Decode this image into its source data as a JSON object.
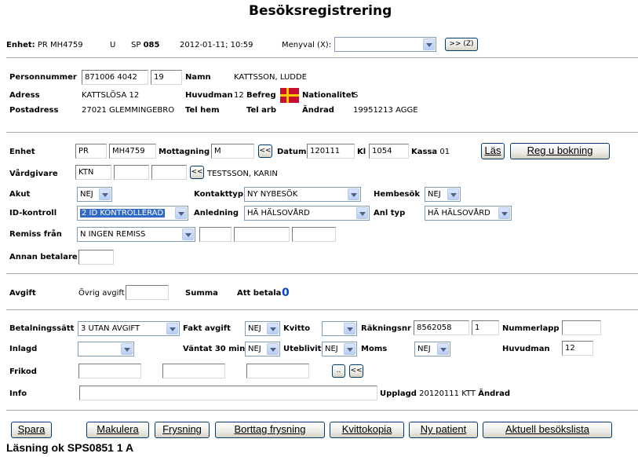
{
  "title": "Besöksregistrering",
  "header": {
    "enhet_label": "Enhet:",
    "enhet_value": "PR MH4759",
    "u": "U",
    "sp_label": "SP",
    "sp_value": "085",
    "datetime": "2012-01-11; 10:59",
    "menyval_label": "Menyval (X):",
    "menyval_value": "",
    "goto_button": ">> (Z)"
  },
  "patient": {
    "personnummer_label": "Personnummer",
    "personnummer_value": "871006 4042",
    "century_value": "19",
    "namn_label": "Namn",
    "namn_value": "KATTSSON, LUDDE",
    "adress_label": "Adress",
    "adress_value": "KATTSLÖSA 12",
    "huvudman_label": "Huvudman",
    "huvudman_value": "12",
    "befreg_label": "Befreg",
    "nationalitet_label": "Nationalitet",
    "nationalitet_value": "S",
    "postadress_label": "Postadress",
    "postadress_value": "27021  GLEMMINGEBRO",
    "telhem_label": "Tel hem",
    "telarb_label": "Tel arb",
    "andrad_label": "Ändrad",
    "andrad_value": "19951213 AGGE"
  },
  "visit": {
    "enhet_label": "Enhet",
    "enhet_a": "PR",
    "enhet_b": "MH4759",
    "mottagning_label": "Mottagning",
    "mottagning_value": "M",
    "mottagning_btn": "<<",
    "datum_label": "Datum",
    "datum_value": "120111",
    "kl_label": "Kl",
    "kl_value": "1054",
    "kassa_label": "Kassa",
    "kassa_value": "01",
    "las_button": "Läs",
    "regbokning_button": "Reg u bokning",
    "vardgivare_label": "Vårdgivare",
    "vardgivare_value": "KTN",
    "vardgivare_btn": "<<",
    "vardgivare_name": "TESTSSON, KARIN",
    "akut_label": "Akut",
    "akut_value": "NEJ",
    "kontakttyp_label": "Kontakttyp",
    "kontakttyp_value": "NY NYBESÖK",
    "hembesok_label": "Hembesök",
    "hembesok_value": "NEJ",
    "idkontroll_label": "ID-kontroll",
    "idkontroll_value": "2 ID KONTROLLERAD",
    "anledning_label": "Anledning",
    "anledning_value": "HÄ HÄLSOVÅRD",
    "anltyp_label": "Anl typ",
    "anltyp_value": "HÄ HÄLSOVÅRD",
    "remiss_label": "Remiss från",
    "remiss_value": "N INGEN REMISS",
    "annan_label": "Annan betalare"
  },
  "fee": {
    "avgift_label": "Avgift",
    "ovrig_label": "Övrig avgift",
    "summa_label": "Summa",
    "attbetala_label": "Att betala",
    "attbetala_value": "0"
  },
  "payment": {
    "betalningssatt_label": "Betalningssätt",
    "betalningssatt_value": "3 UTAN AVGIFT",
    "faktavgift_label": "Fakt avgift",
    "faktavgift_value": "NEJ",
    "kvitto_label": "Kvitto",
    "kvitto_value": "",
    "rakningsnr_label": "Räkningsnr",
    "rakningsnr_value": "8562058",
    "rakningsnr_b": "1",
    "nummerlapp_label": "Nummerlapp",
    "inlagd_label": "Inlagd",
    "inlagd_value": "",
    "vantat_label": "Väntat 30 min",
    "vantat_value": "NEJ",
    "uteblivit_label": "Uteblivit",
    "uteblivit_value": "NEJ",
    "moms_label": "Moms",
    "moms_value": "NEJ",
    "huvudman_label": "Huvudman",
    "huvudman_value": "12",
    "frikod_label": "Frikod",
    "dots_btn": "..",
    "back_btn": "<<",
    "info_label": "Info",
    "upplagd_label": "Upplagd",
    "upplagd_value": "20120111 KTT",
    "andrad_label": "Ändrad"
  },
  "buttons": {
    "spara": "Spara",
    "makulera": "Makulera",
    "frysning": "Frysning",
    "borttag": "Borttag frysning",
    "kvittokopia": "Kvittokopia",
    "nypatient": "Ny patient",
    "aktuell": "Aktuell besökslista"
  },
  "status": "Läsning ok SPS0851 1 A"
}
